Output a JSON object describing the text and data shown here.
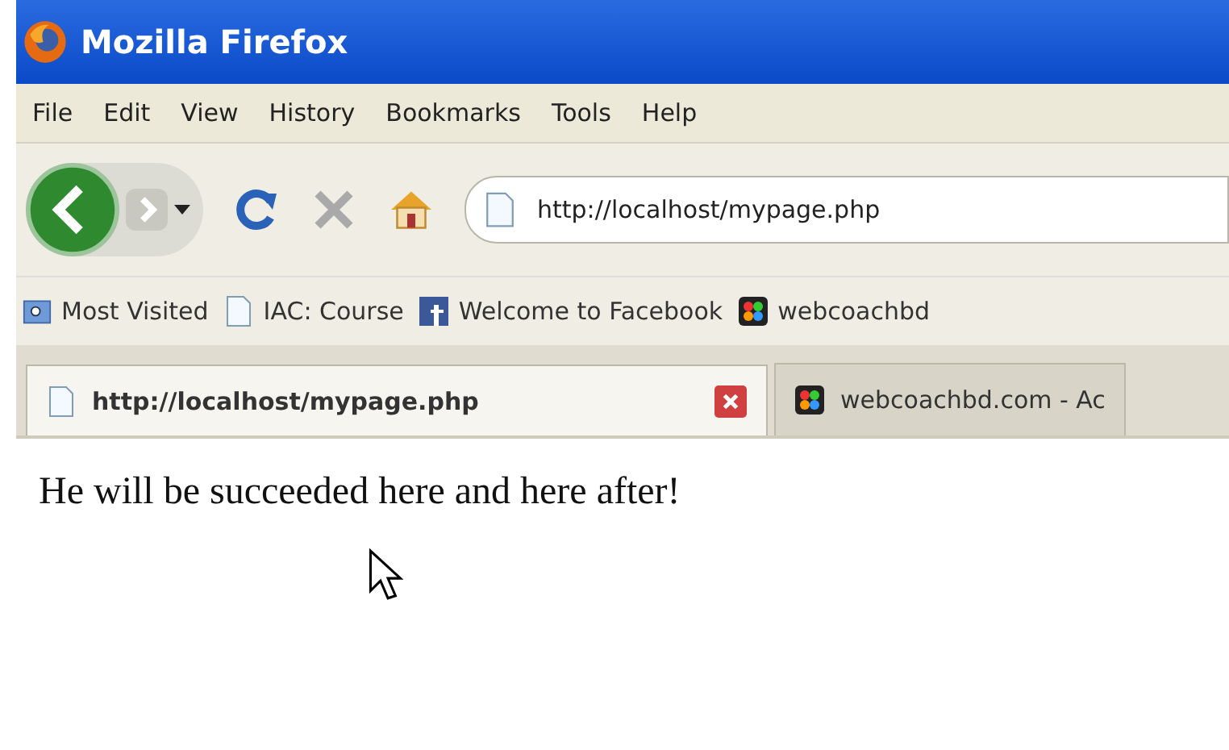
{
  "window": {
    "title": "Mozilla Firefox"
  },
  "menu": [
    {
      "label": "File"
    },
    {
      "label": "Edit"
    },
    {
      "label": "View"
    },
    {
      "label": "History"
    },
    {
      "label": "Bookmarks"
    },
    {
      "label": "Tools"
    },
    {
      "label": "Help"
    }
  ],
  "toolbar": {
    "url": "http://localhost/mypage.php"
  },
  "bookmarks": [
    {
      "kind": "folder",
      "label": "Most Visited"
    },
    {
      "kind": "page",
      "label": "IAC: Course"
    },
    {
      "kind": "facebook",
      "label": "Welcome to Facebook"
    },
    {
      "kind": "mosaic",
      "label": "webcoachbd"
    }
  ],
  "tabs": [
    {
      "kind": "page",
      "label": "http://localhost/mypage.php",
      "selected": true
    },
    {
      "kind": "mosaic",
      "label": "webcoachbd.com - Ac",
      "selected": false
    }
  ],
  "content": {
    "text": "He will be succeeded here and here after!"
  }
}
